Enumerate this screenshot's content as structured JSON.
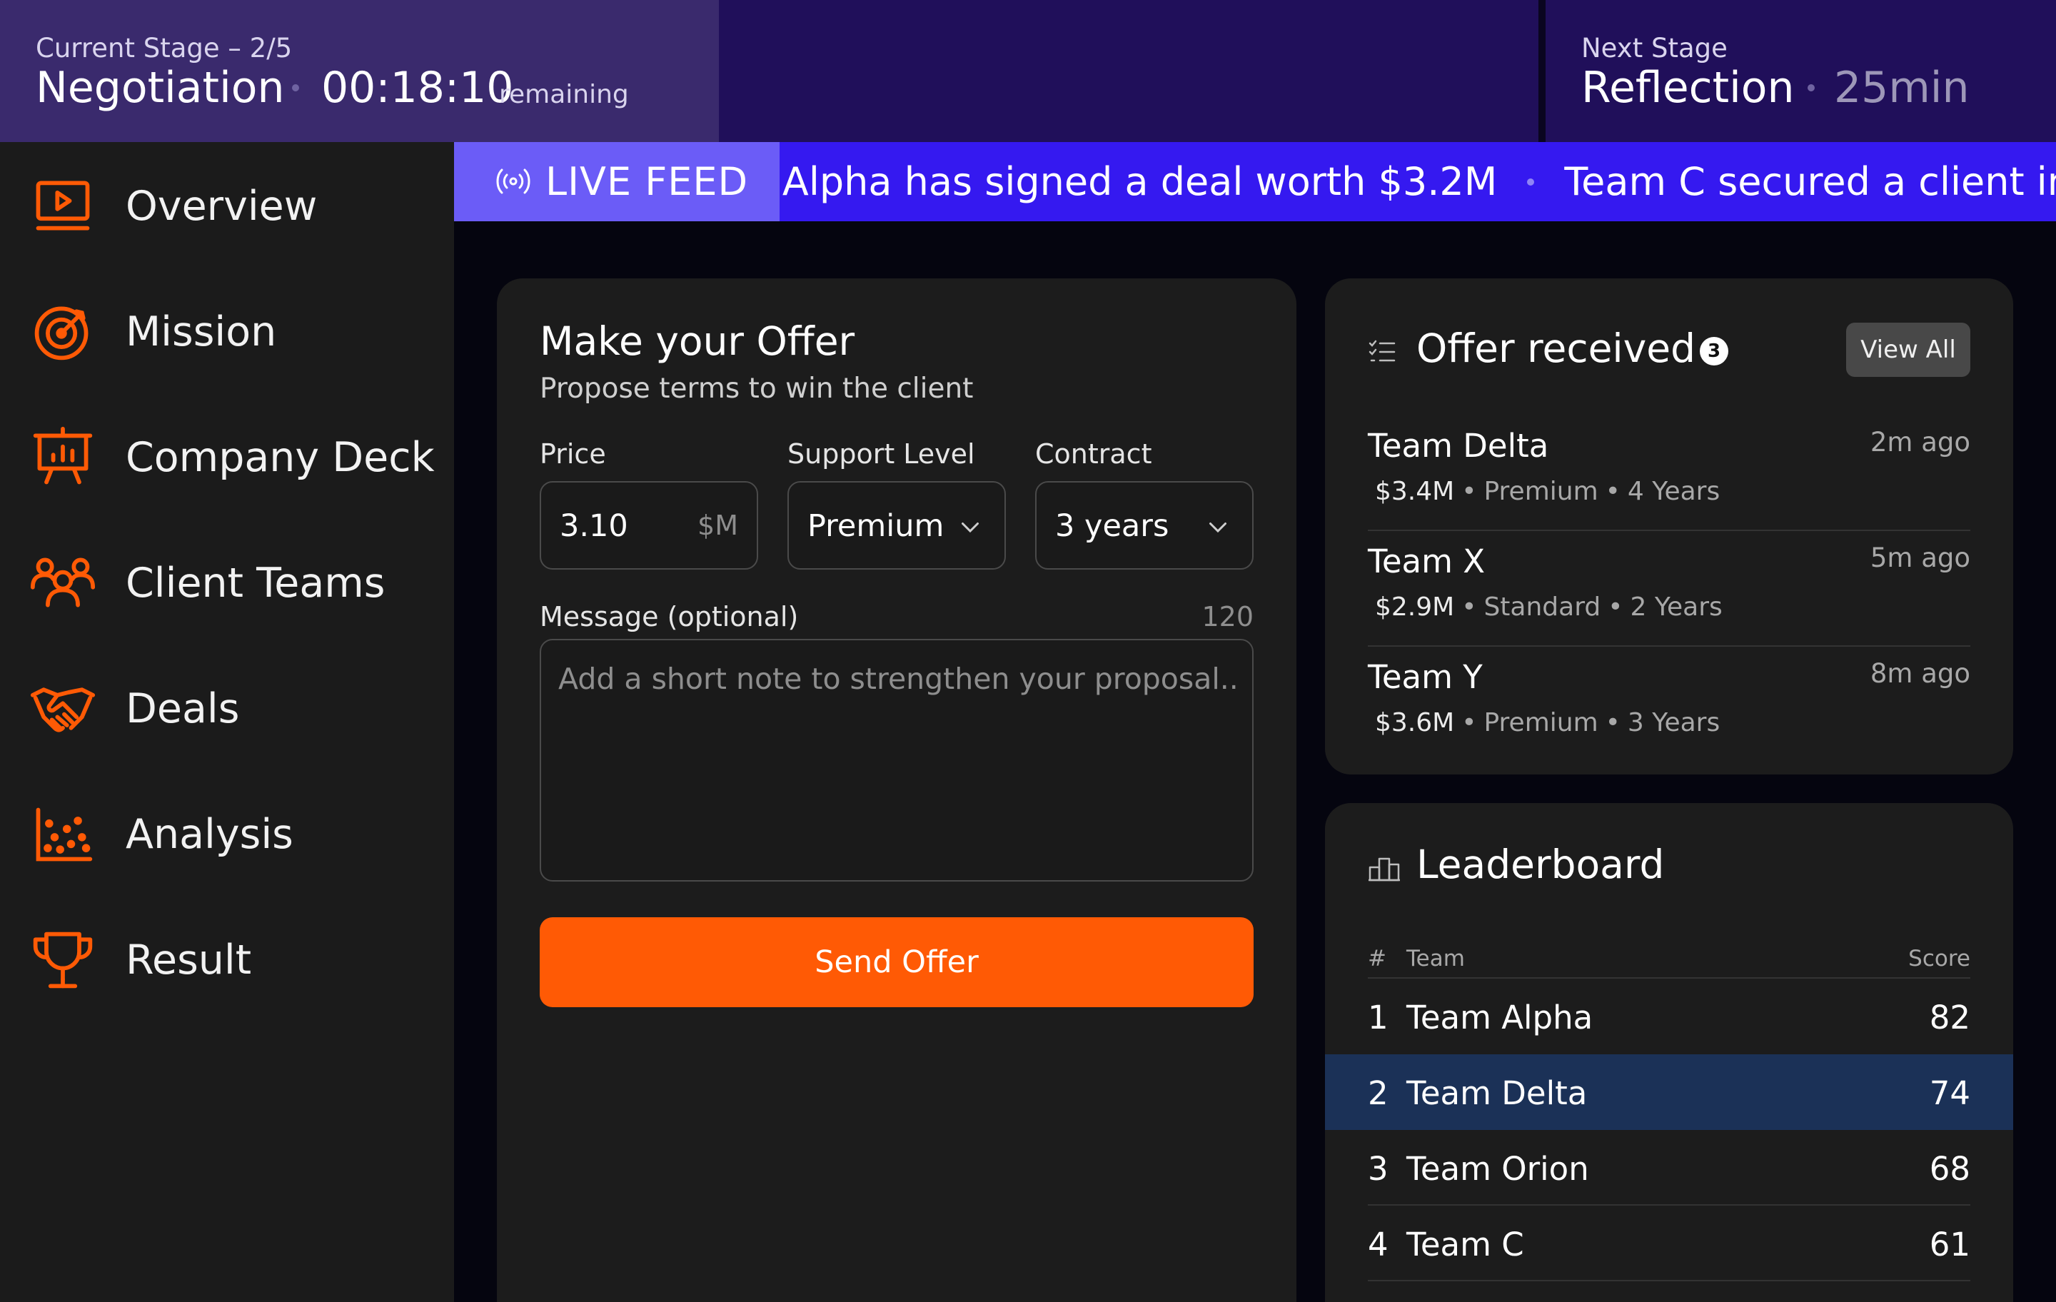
{
  "colors": {
    "accent": "#ff5a05",
    "nav_icon": "#ff5a05",
    "live_bar": "#3519f0",
    "live_badge": "#6b5cf7",
    "highlight_row": "#1b3157"
  },
  "header": {
    "current_label": "Current Stage – 2/5",
    "current_stage": "Negotiation",
    "timer": "00:18:10",
    "timer_suffix": "remaining",
    "next_label": "Next Stage",
    "next_stage": "Reflection",
    "next_duration": "25min"
  },
  "sidebar": {
    "items": [
      {
        "label": "Overview",
        "icon": "play-screen-icon"
      },
      {
        "label": "Mission",
        "icon": "target-icon"
      },
      {
        "label": "Company Deck",
        "icon": "presentation-icon"
      },
      {
        "label": "Client Teams",
        "icon": "team-icon"
      },
      {
        "label": "Deals",
        "icon": "handshake-icon"
      },
      {
        "label": "Analysis",
        "icon": "scatter-chart-icon"
      },
      {
        "label": "Result",
        "icon": "trophy-icon"
      }
    ]
  },
  "live_feed": {
    "label": "LIVE FEED",
    "items": [
      "Team Alpha has signed a deal worth $3.2M",
      "Team C secured a client in Asia"
    ]
  },
  "offer_form": {
    "title": "Make your Offer",
    "subtitle": "Propose terms to win the client",
    "price_label": "Price",
    "price_value": "3.10",
    "price_unit": "$M",
    "support_label": "Support Level",
    "support_value": "Premium",
    "contract_label": "Contract",
    "contract_value": "3 years",
    "message_label": "Message (optional)",
    "message_limit": "120",
    "message_placeholder": "Add a short note to strengthen your proposal..",
    "send_label": "Send Offer"
  },
  "offers_received": {
    "title": "Offer received",
    "count": "3",
    "view_all": "View All",
    "items": [
      {
        "team": "Team Delta",
        "time": "2m ago",
        "price": "$3.4M",
        "support": "Premium",
        "years": "4 Years"
      },
      {
        "team": "Team X",
        "time": "5m ago",
        "price": "$2.9M",
        "support": "Standard",
        "years": "2 Years"
      },
      {
        "team": "Team Y",
        "time": "8m ago",
        "price": "$3.6M",
        "support": "Premium",
        "years": "3 Years"
      }
    ]
  },
  "leaderboard": {
    "title": "Leaderboard",
    "col_rank": "#",
    "col_team": "Team",
    "col_score": "Score",
    "rows": [
      {
        "rank": "1",
        "team": "Team Alpha",
        "score": "82"
      },
      {
        "rank": "2",
        "team": "Team Delta",
        "score": "74"
      },
      {
        "rank": "3",
        "team": "Team Orion",
        "score": "68"
      },
      {
        "rank": "4",
        "team": "Team C",
        "score": "61"
      }
    ]
  }
}
